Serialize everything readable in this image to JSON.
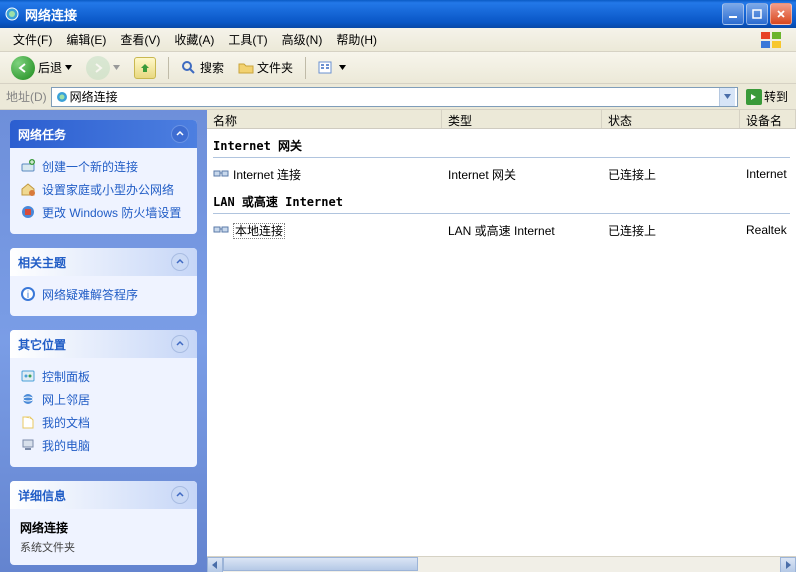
{
  "title": "网络连接",
  "menus": {
    "file": "文件(F)",
    "edit": "编辑(E)",
    "view": "查看(V)",
    "fav": "收藏(A)",
    "tools": "工具(T)",
    "adv": "高级(N)",
    "help": "帮助(H)"
  },
  "toolbar": {
    "back": "后退",
    "search": "搜索",
    "folders": "文件夹"
  },
  "address": {
    "label": "地址(D)",
    "value": "网络连接",
    "go": "转到"
  },
  "sidebar": {
    "tasks": {
      "title": "网络任务",
      "items": [
        {
          "label": "创建一个新的连接",
          "icon": "new-conn"
        },
        {
          "label": "设置家庭或小型办公网络",
          "icon": "home-net"
        },
        {
          "label": "更改 Windows 防火墙设置",
          "icon": "firewall"
        }
      ]
    },
    "related": {
      "title": "相关主题",
      "items": [
        {
          "label": "网络疑难解答程序",
          "icon": "help"
        }
      ]
    },
    "other": {
      "title": "其它位置",
      "items": [
        {
          "label": "控制面板",
          "icon": "cpanel"
        },
        {
          "label": "网上邻居",
          "icon": "neighbor"
        },
        {
          "label": "我的文档",
          "icon": "docs"
        },
        {
          "label": "我的电脑",
          "icon": "computer"
        }
      ]
    },
    "details": {
      "title": "详细信息",
      "name": "网络连接",
      "type": "系统文件夹"
    }
  },
  "columns": {
    "name": "名称",
    "type": "类型",
    "status": "状态",
    "device": "设备名"
  },
  "groups": [
    {
      "title": "Internet 网关",
      "rows": [
        {
          "name": "Internet 连接",
          "type": "Internet 网关",
          "status": "已连接上",
          "device": "Internet"
        }
      ]
    },
    {
      "title": "LAN 或高速 Internet",
      "rows": [
        {
          "name": "本地连接",
          "type": "LAN 或高速 Internet",
          "status": "已连接上",
          "device": "Realtek",
          "selected": true
        }
      ]
    }
  ]
}
